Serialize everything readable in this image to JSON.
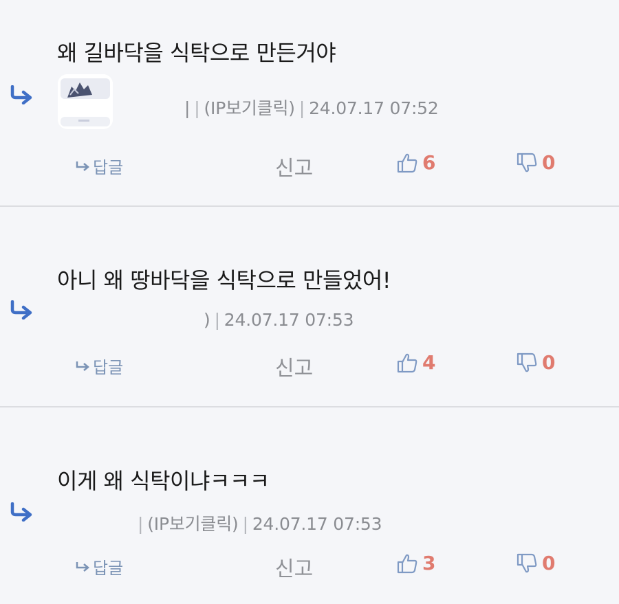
{
  "comments": [
    {
      "text": "왜 길바닥을 식탁으로 만든거야",
      "author_tail": "|",
      "ip_label": "(IP보기클릭)",
      "timestamp": "24.07.17 07:52",
      "reply_label": "답글",
      "report_label": "신고",
      "likes": "6",
      "dislikes": "0"
    },
    {
      "text": "아니 왜 땅바닥을 식탁으로 만들었어!",
      "author_tail": ")",
      "ip_label": "",
      "timestamp": "24.07.17 07:53",
      "reply_label": "답글",
      "report_label": "신고",
      "likes": "4",
      "dislikes": "0"
    },
    {
      "text": "이게 왜 식탁이냐ㅋㅋㅋ",
      "author_tail": "",
      "ip_label": "(IP보기클릭)",
      "timestamp": "24.07.17 07:53",
      "reply_label": "답글",
      "report_label": "신고",
      "likes": "3",
      "dislikes": "0"
    }
  ],
  "icons": {
    "reply": "reply-arrow-icon",
    "like": "thumbs-up-icon",
    "dislike": "thumbs-down-icon"
  },
  "colors": {
    "reply_arrow": "#3f6fc6",
    "count": "#e07b6f",
    "thumb": "#7f9ac4"
  }
}
